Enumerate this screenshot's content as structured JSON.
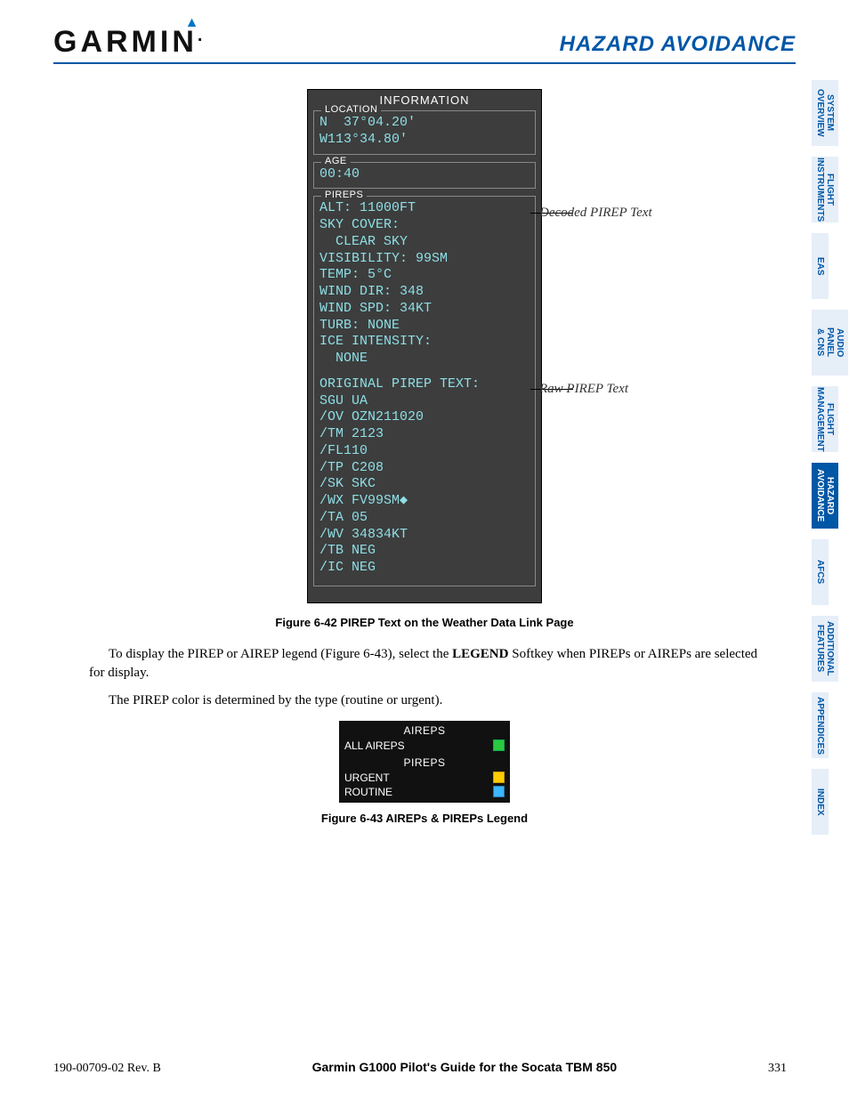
{
  "header": {
    "brand": "GARMIN",
    "section": "HAZARD AVOIDANCE"
  },
  "tabs": [
    {
      "label": "SYSTEM OVERVIEW",
      "active": false
    },
    {
      "label": "FLIGHT INSTRUMENTS",
      "active": false
    },
    {
      "label": "EAS",
      "active": false
    },
    {
      "label": "AUDIO PANEL & CNS",
      "active": false
    },
    {
      "label": "FLIGHT MANAGEMENT",
      "active": false
    },
    {
      "label": "HAZARD AVOIDANCE",
      "active": true
    },
    {
      "label": "AFCS",
      "active": false
    },
    {
      "label": "ADDITIONAL FEATURES",
      "active": false
    },
    {
      "label": "APPENDICES",
      "active": false
    },
    {
      "label": "INDEX",
      "active": false
    }
  ],
  "pirep": {
    "title": "INFORMATION",
    "location_label": "LOCATION",
    "location_lat": "N  37°04.20'",
    "location_lon": "W113°34.80'",
    "age_label": "AGE",
    "age_value": "00:40",
    "pireps_label": "PIREPS",
    "decoded": [
      "ALT: 11000FT",
      "SKY COVER:",
      "  CLEAR SKY",
      "VISIBILITY: 99SM",
      "TEMP: 5°C",
      "WIND DIR: 348",
      "WIND SPD: 34KT",
      "TURB: NONE",
      "ICE INTENSITY:",
      "  NONE"
    ],
    "raw_label": "ORIGINAL PIREP TEXT:",
    "raw": [
      "SGU UA",
      "/OV OZN211020",
      "/TM 2123",
      "/FL110",
      "/TP C208",
      "/SK SKC",
      "/WX FV99SM◆",
      "/TA 05",
      "/WV 34834KT",
      "/TB NEG",
      "/IC NEG"
    ],
    "annot_decoded": "Decoded PIREP Text",
    "annot_raw": "Raw PIREP Text"
  },
  "captions": {
    "fig642": "Figure 6-42  PIREP Text on the Weather Data Link Page",
    "fig643": "Figure 6-43  AIREPs & PIREPs Legend"
  },
  "paragraphs": {
    "p1a": "To display the PIREP or AIREP legend (Figure 6-43), select the ",
    "p1b": "LEGEND",
    "p1c": " Softkey when PIREPs or AIREPs are selected for display.",
    "p2": "The PIREP color is determined by the type (routine or urgent)."
  },
  "legend": {
    "aireps_head": "AIREPS",
    "aireps_row": "ALL AIREPS",
    "pireps_head": "PIREPS",
    "urgent": "URGENT",
    "routine": "ROUTINE"
  },
  "footer": {
    "docid": "190-00709-02  Rev. B",
    "title": "Garmin G1000 Pilot's Guide for the Socata TBM 850",
    "page": "331"
  }
}
